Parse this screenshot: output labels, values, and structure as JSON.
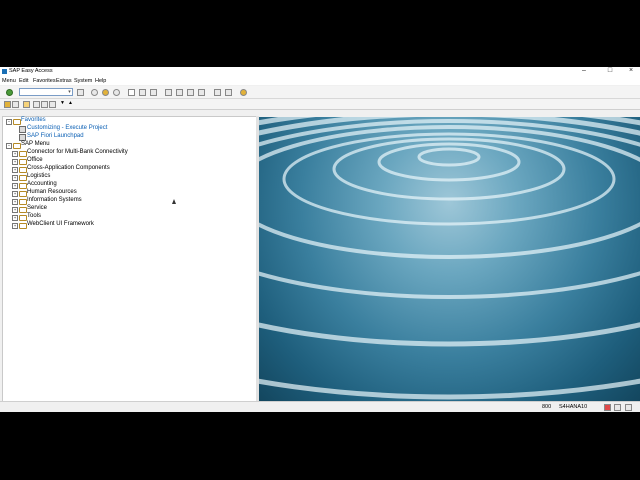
{
  "window": {
    "title": "SAP Easy Access",
    "minimize": "–",
    "maximize": "□",
    "close": "×"
  },
  "menubar": [
    "Menu",
    "Edit",
    "Favorites",
    "Extras",
    "System",
    "Help"
  ],
  "command_field": {
    "value": ""
  },
  "tree": {
    "favorites_label": "Favorites",
    "favorites": [
      "Customizing - Execute Project",
      "SAP Fiori Launchpad"
    ],
    "sap_menu_label": "SAP Menu",
    "items": [
      "Connector for Multi-Bank Connectivity",
      "Office",
      "Cross-Application Components",
      "Logistics",
      "Accounting",
      "Human Resources",
      "Information Systems",
      "Service",
      "Tools",
      "WebClient UI Framework"
    ]
  },
  "statusbar": {
    "client": "800",
    "system": "S4HANA10"
  },
  "colors": {
    "link": "#0a5fb4",
    "folder": "#b58a26",
    "water_light": "#9ec7d8",
    "water_dark": "#13465e"
  },
  "icons": [
    "sap-logo-icon",
    "enter-icon",
    "save-icon",
    "back-icon",
    "exit-icon",
    "cancel-icon",
    "print-icon",
    "find-icon",
    "find-next-icon",
    "first-page-icon",
    "previous-page-icon",
    "next-page-icon",
    "last-page-icon",
    "new-session-icon",
    "shortcut-icon",
    "help-icon"
  ]
}
